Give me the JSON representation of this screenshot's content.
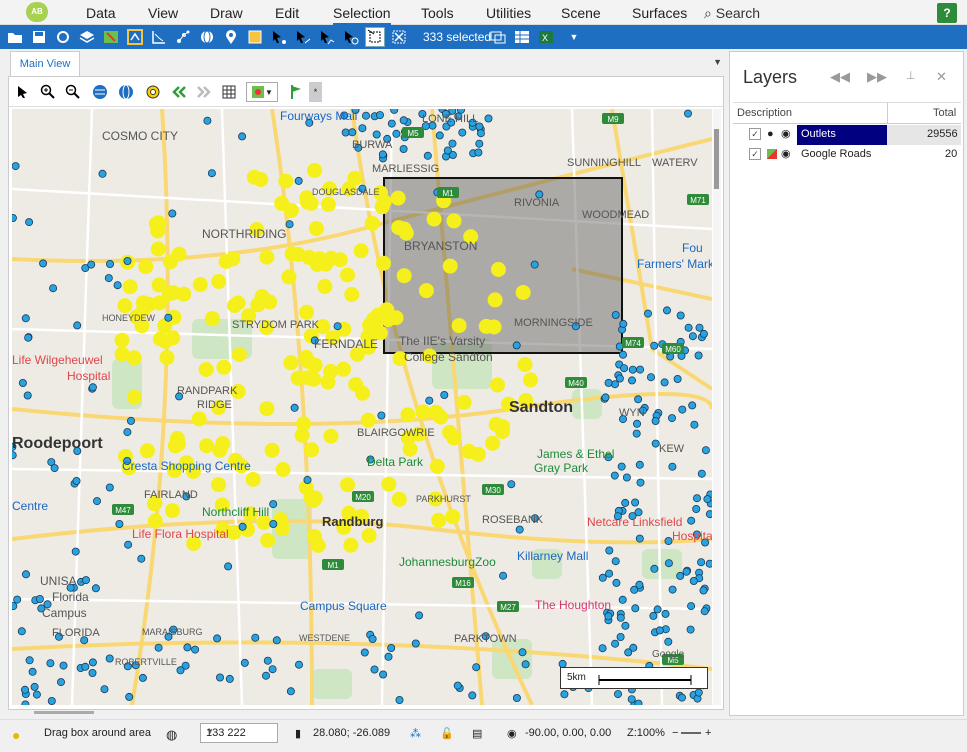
{
  "menu": {
    "items": [
      "Data",
      "View",
      "Draw",
      "Edit",
      "Selection",
      "Tools",
      "Utilities",
      "Scene",
      "Surfaces"
    ],
    "search_label": "Search",
    "help_label": "?"
  },
  "toolbar": {
    "selected_count": "333 selected",
    "icons": [
      "open-folder-icon",
      "save-icon",
      "sync-icon",
      "layers-icon",
      "map-icon",
      "route-icon",
      "chart-icon",
      "scatter-icon",
      "globe-icon",
      "pin-icon",
      "polygon-icon",
      "select-point-icon",
      "select-line-icon",
      "select-path-icon",
      "select-region-icon",
      "box-select-icon",
      "clear-selection-icon",
      "table-icon",
      "spreadsheet-icon",
      "excel-icon"
    ]
  },
  "tabs": {
    "main": "Main View"
  },
  "map": {
    "labels": [
      {
        "text": "COSMO CITY",
        "size": 12,
        "cls": ""
      },
      {
        "text": "Fourways Mall",
        "size": 12,
        "cls": "poi-blue"
      },
      {
        "text": "LONE HILL",
        "size": 11,
        "cls": ""
      },
      {
        "text": "BURWA",
        "size": 11,
        "cls": ""
      },
      {
        "text": "MARLIESSIG",
        "size": 11,
        "cls": ""
      },
      {
        "text": "SUNNINGHILL",
        "size": 11,
        "cls": ""
      },
      {
        "text": "WATERV",
        "size": 11,
        "cls": ""
      },
      {
        "text": "DOUGLASDALE",
        "size": 9,
        "cls": ""
      },
      {
        "text": "RIVONIA",
        "size": 11,
        "cls": ""
      },
      {
        "text": "WOODMEAD",
        "size": 11,
        "cls": ""
      },
      {
        "text": "NORTHRIDING",
        "size": 12,
        "cls": ""
      },
      {
        "text": "BRYANSTON",
        "size": 12,
        "cls": ""
      },
      {
        "text": "Fou",
        "size": 12,
        "cls": "poi-blue"
      },
      {
        "text": "Farmers' Mark",
        "size": 12,
        "cls": "poi-blue"
      },
      {
        "text": "HONEYDEW",
        "size": 9,
        "cls": ""
      },
      {
        "text": "STRYDOM PARK",
        "size": 11,
        "cls": ""
      },
      {
        "text": "FERNDALE",
        "size": 12,
        "cls": ""
      },
      {
        "text": "MORNINGSIDE",
        "size": 11,
        "cls": ""
      },
      {
        "text": "The IIE's Varsity",
        "size": 12,
        "cls": ""
      },
      {
        "text": "College Sandton",
        "size": 12,
        "cls": ""
      },
      {
        "text": "Life Wilgeheuwel",
        "size": 12,
        "cls": "poi-red"
      },
      {
        "text": "Hospital",
        "size": 12,
        "cls": "poi-red"
      },
      {
        "text": "RANDPARK",
        "size": 11,
        "cls": ""
      },
      {
        "text": "RIDGE",
        "size": 11,
        "cls": ""
      },
      {
        "text": "Sandton",
        "size": 16,
        "cls": "big"
      },
      {
        "text": "WYN",
        "size": 11,
        "cls": ""
      },
      {
        "text": "Roodepoort",
        "size": 16,
        "cls": "big"
      },
      {
        "text": "BLAIRGOWRIE",
        "size": 11,
        "cls": ""
      },
      {
        "text": "Delta Park",
        "size": 12,
        "cls": "poi-green"
      },
      {
        "text": "James & Ethel",
        "size": 12,
        "cls": "poi-green"
      },
      {
        "text": "Gray Park",
        "size": 12,
        "cls": "poi-green"
      },
      {
        "text": "KEW",
        "size": 11,
        "cls": ""
      },
      {
        "text": "Cresta Shopping Centre",
        "size": 12,
        "cls": "poi-blue"
      },
      {
        "text": "FAIRLAND",
        "size": 11,
        "cls": ""
      },
      {
        "text": "PARKHURST",
        "size": 9,
        "cls": ""
      },
      {
        "text": "Centre",
        "size": 12,
        "cls": "poi-blue"
      },
      {
        "text": "Northcliff Hill",
        "size": 12,
        "cls": "poi-green"
      },
      {
        "text": "Randburg",
        "size": 13,
        "cls": "big"
      },
      {
        "text": "ROSEBANK",
        "size": 11,
        "cls": ""
      },
      {
        "text": "Netcare Linksfield",
        "size": 12,
        "cls": "poi-red"
      },
      {
        "text": "Hospital",
        "size": 12,
        "cls": "poi-red"
      },
      {
        "text": "Life Flora Hospital",
        "size": 12,
        "cls": "poi-red"
      },
      {
        "text": "JohannesburgZoo",
        "size": 12,
        "cls": "poi-green"
      },
      {
        "text": "Killarney Mall",
        "size": 12,
        "cls": "poi-blue"
      },
      {
        "text": "UNISA -",
        "size": 12,
        "cls": ""
      },
      {
        "text": "Florida",
        "size": 12,
        "cls": ""
      },
      {
        "text": "Campus",
        "size": 12,
        "cls": ""
      },
      {
        "text": "Campus Square",
        "size": 12,
        "cls": "poi-blue"
      },
      {
        "text": "The Houghton",
        "size": 12,
        "cls": "poi-pink"
      },
      {
        "text": "FLORIDA",
        "size": 11,
        "cls": ""
      },
      {
        "text": "MARAISBURG",
        "size": 9,
        "cls": ""
      },
      {
        "text": "WESTDENE",
        "size": 9,
        "cls": ""
      },
      {
        "text": "PARKTOWN",
        "size": 11,
        "cls": ""
      },
      {
        "text": "ROBERTVILLE",
        "size": 9,
        "cls": ""
      },
      {
        "text": "Google",
        "size": 10,
        "cls": ""
      }
    ],
    "roads": [
      "M9",
      "M5",
      "M1",
      "M71",
      "M74",
      "M60",
      "M40",
      "M20",
      "M30",
      "M16",
      "M27",
      "M47",
      "M1",
      "M5"
    ],
    "scale_label": "5km"
  },
  "layers": {
    "title": "Layers",
    "columns": {
      "description": "Description",
      "total": "Total"
    },
    "rows": [
      {
        "name": "Outlets",
        "total": "29556",
        "selected": true
      },
      {
        "name": "Google Roads",
        "total": "20",
        "selected": false
      }
    ]
  },
  "status": {
    "message": "Drag box around area",
    "combo_value": "133 222",
    "coords": "28.080; -26.089",
    "rotation": "-90.00, 0.00, 0.00",
    "zoom": "Z:100%"
  }
}
